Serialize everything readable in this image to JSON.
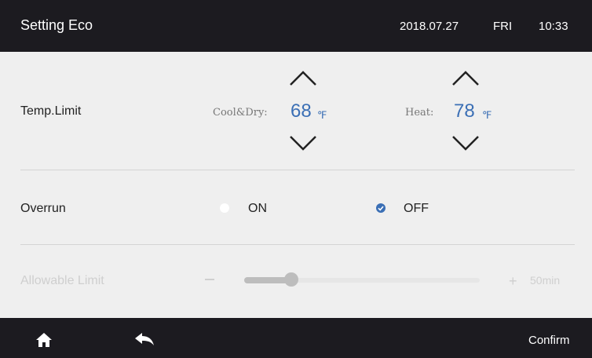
{
  "header": {
    "title": "Setting Eco",
    "date": "2018.07.27",
    "day": "FRI",
    "time": "10:33"
  },
  "temp_limit": {
    "label": "Temp.Limit",
    "cool_dry": {
      "label": "Cool&Dry:",
      "value": "68",
      "unit": "℉"
    },
    "heat": {
      "label": "Heat:",
      "value": "78",
      "unit": "℉"
    }
  },
  "overrun": {
    "label": "Overrun",
    "options": [
      {
        "label": "ON",
        "selected": false
      },
      {
        "label": "OFF",
        "selected": true
      }
    ]
  },
  "allowable_limit": {
    "label": "Allowable Limit",
    "value": "50min",
    "slider_fraction": 0.2,
    "enabled": false
  },
  "footer": {
    "confirm_label": "Confirm",
    "home_icon": "home-icon",
    "back_icon": "back-arrow-icon"
  },
  "colors": {
    "accent": "#3b6fb5",
    "bar_background": "#1c1b20",
    "panel_background": "#efefef"
  }
}
